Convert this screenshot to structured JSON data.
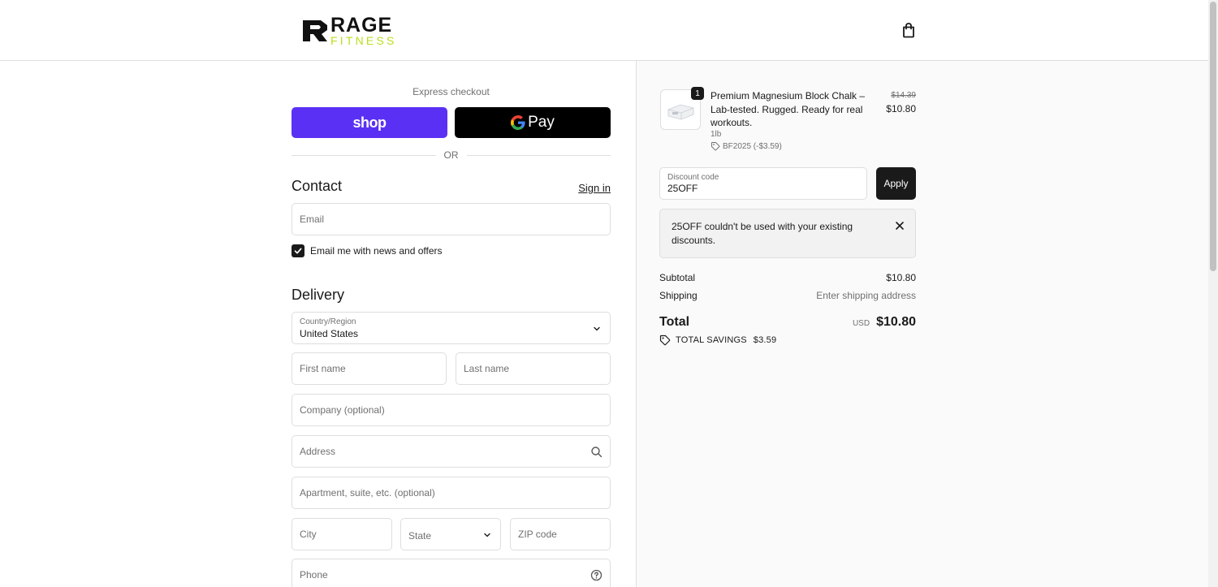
{
  "brand": {
    "logo_line1": "RAGE",
    "logo_line2": "FITNESS",
    "accent_color": "#b7df1c"
  },
  "header": {
    "cart_icon": "shopping-bag-icon"
  },
  "express": {
    "label": "Express checkout",
    "shop_pay_label": "shop",
    "shop_pay_color": "#5a31f4",
    "gpay_label": "Pay",
    "divider_text": "OR"
  },
  "contact": {
    "title": "Contact",
    "sign_in": "Sign in",
    "email_placeholder": "Email",
    "newsletter_label": "Email me with news and offers",
    "newsletter_checked": true
  },
  "delivery": {
    "title": "Delivery",
    "country_label": "Country/Region",
    "country_value": "United States",
    "first_name_placeholder": "First name",
    "last_name_placeholder": "Last name",
    "company_placeholder": "Company (optional)",
    "address_placeholder": "Address",
    "apartment_placeholder": "Apartment, suite, etc. (optional)",
    "city_placeholder": "City",
    "state_placeholder": "State",
    "zip_placeholder": "ZIP code",
    "phone_placeholder": "Phone"
  },
  "order": {
    "item": {
      "quantity": "1",
      "name": "Premium Magnesium Block Chalk – Lab-tested. Rugged. Ready for real workouts.",
      "variant": "1lb",
      "discount_tag": "BF2025 (-$3.59)",
      "price_original": "$14.39",
      "price_final": "$10.80"
    },
    "discount": {
      "label": "Discount code",
      "value": "25OFF",
      "apply_label": "Apply"
    },
    "notice": "25OFF couldn't be used with your existing discounts.",
    "subtotal_label": "Subtotal",
    "subtotal_value": "$10.80",
    "shipping_label": "Shipping",
    "shipping_value": "Enter shipping address",
    "total_label": "Total",
    "total_currency": "USD",
    "total_value": "$10.80",
    "savings_label": "TOTAL SAVINGS",
    "savings_value": "$3.59"
  }
}
